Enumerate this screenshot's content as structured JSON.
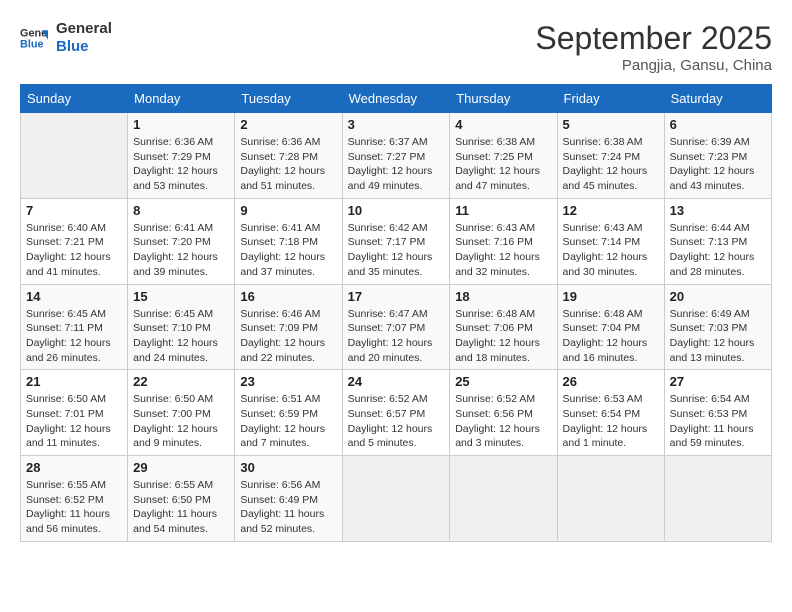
{
  "header": {
    "logo_line1": "General",
    "logo_line2": "Blue",
    "month": "September 2025",
    "location": "Pangjia, Gansu, China"
  },
  "weekdays": [
    "Sunday",
    "Monday",
    "Tuesday",
    "Wednesday",
    "Thursday",
    "Friday",
    "Saturday"
  ],
  "weeks": [
    [
      {
        "day": "",
        "empty": true
      },
      {
        "day": "1",
        "sunrise": "6:36 AM",
        "sunset": "7:29 PM",
        "daylight": "12 hours and 53 minutes."
      },
      {
        "day": "2",
        "sunrise": "6:36 AM",
        "sunset": "7:28 PM",
        "daylight": "12 hours and 51 minutes."
      },
      {
        "day": "3",
        "sunrise": "6:37 AM",
        "sunset": "7:27 PM",
        "daylight": "12 hours and 49 minutes."
      },
      {
        "day": "4",
        "sunrise": "6:38 AM",
        "sunset": "7:25 PM",
        "daylight": "12 hours and 47 minutes."
      },
      {
        "day": "5",
        "sunrise": "6:38 AM",
        "sunset": "7:24 PM",
        "daylight": "12 hours and 45 minutes."
      },
      {
        "day": "6",
        "sunrise": "6:39 AM",
        "sunset": "7:23 PM",
        "daylight": "12 hours and 43 minutes."
      }
    ],
    [
      {
        "day": "7",
        "sunrise": "6:40 AM",
        "sunset": "7:21 PM",
        "daylight": "12 hours and 41 minutes."
      },
      {
        "day": "8",
        "sunrise": "6:41 AM",
        "sunset": "7:20 PM",
        "daylight": "12 hours and 39 minutes."
      },
      {
        "day": "9",
        "sunrise": "6:41 AM",
        "sunset": "7:18 PM",
        "daylight": "12 hours and 37 minutes."
      },
      {
        "day": "10",
        "sunrise": "6:42 AM",
        "sunset": "7:17 PM",
        "daylight": "12 hours and 35 minutes."
      },
      {
        "day": "11",
        "sunrise": "6:43 AM",
        "sunset": "7:16 PM",
        "daylight": "12 hours and 32 minutes."
      },
      {
        "day": "12",
        "sunrise": "6:43 AM",
        "sunset": "7:14 PM",
        "daylight": "12 hours and 30 minutes."
      },
      {
        "day": "13",
        "sunrise": "6:44 AM",
        "sunset": "7:13 PM",
        "daylight": "12 hours and 28 minutes."
      }
    ],
    [
      {
        "day": "14",
        "sunrise": "6:45 AM",
        "sunset": "7:11 PM",
        "daylight": "12 hours and 26 minutes."
      },
      {
        "day": "15",
        "sunrise": "6:45 AM",
        "sunset": "7:10 PM",
        "daylight": "12 hours and 24 minutes."
      },
      {
        "day": "16",
        "sunrise": "6:46 AM",
        "sunset": "7:09 PM",
        "daylight": "12 hours and 22 minutes."
      },
      {
        "day": "17",
        "sunrise": "6:47 AM",
        "sunset": "7:07 PM",
        "daylight": "12 hours and 20 minutes."
      },
      {
        "day": "18",
        "sunrise": "6:48 AM",
        "sunset": "7:06 PM",
        "daylight": "12 hours and 18 minutes."
      },
      {
        "day": "19",
        "sunrise": "6:48 AM",
        "sunset": "7:04 PM",
        "daylight": "12 hours and 16 minutes."
      },
      {
        "day": "20",
        "sunrise": "6:49 AM",
        "sunset": "7:03 PM",
        "daylight": "12 hours and 13 minutes."
      }
    ],
    [
      {
        "day": "21",
        "sunrise": "6:50 AM",
        "sunset": "7:01 PM",
        "daylight": "12 hours and 11 minutes."
      },
      {
        "day": "22",
        "sunrise": "6:50 AM",
        "sunset": "7:00 PM",
        "daylight": "12 hours and 9 minutes."
      },
      {
        "day": "23",
        "sunrise": "6:51 AM",
        "sunset": "6:59 PM",
        "daylight": "12 hours and 7 minutes."
      },
      {
        "day": "24",
        "sunrise": "6:52 AM",
        "sunset": "6:57 PM",
        "daylight": "12 hours and 5 minutes."
      },
      {
        "day": "25",
        "sunrise": "6:52 AM",
        "sunset": "6:56 PM",
        "daylight": "12 hours and 3 minutes."
      },
      {
        "day": "26",
        "sunrise": "6:53 AM",
        "sunset": "6:54 PM",
        "daylight": "12 hours and 1 minute."
      },
      {
        "day": "27",
        "sunrise": "6:54 AM",
        "sunset": "6:53 PM",
        "daylight": "11 hours and 59 minutes."
      }
    ],
    [
      {
        "day": "28",
        "sunrise": "6:55 AM",
        "sunset": "6:52 PM",
        "daylight": "11 hours and 56 minutes."
      },
      {
        "day": "29",
        "sunrise": "6:55 AM",
        "sunset": "6:50 PM",
        "daylight": "11 hours and 54 minutes."
      },
      {
        "day": "30",
        "sunrise": "6:56 AM",
        "sunset": "6:49 PM",
        "daylight": "11 hours and 52 minutes."
      },
      {
        "day": "",
        "empty": true
      },
      {
        "day": "",
        "empty": true
      },
      {
        "day": "",
        "empty": true
      },
      {
        "day": "",
        "empty": true
      }
    ]
  ]
}
